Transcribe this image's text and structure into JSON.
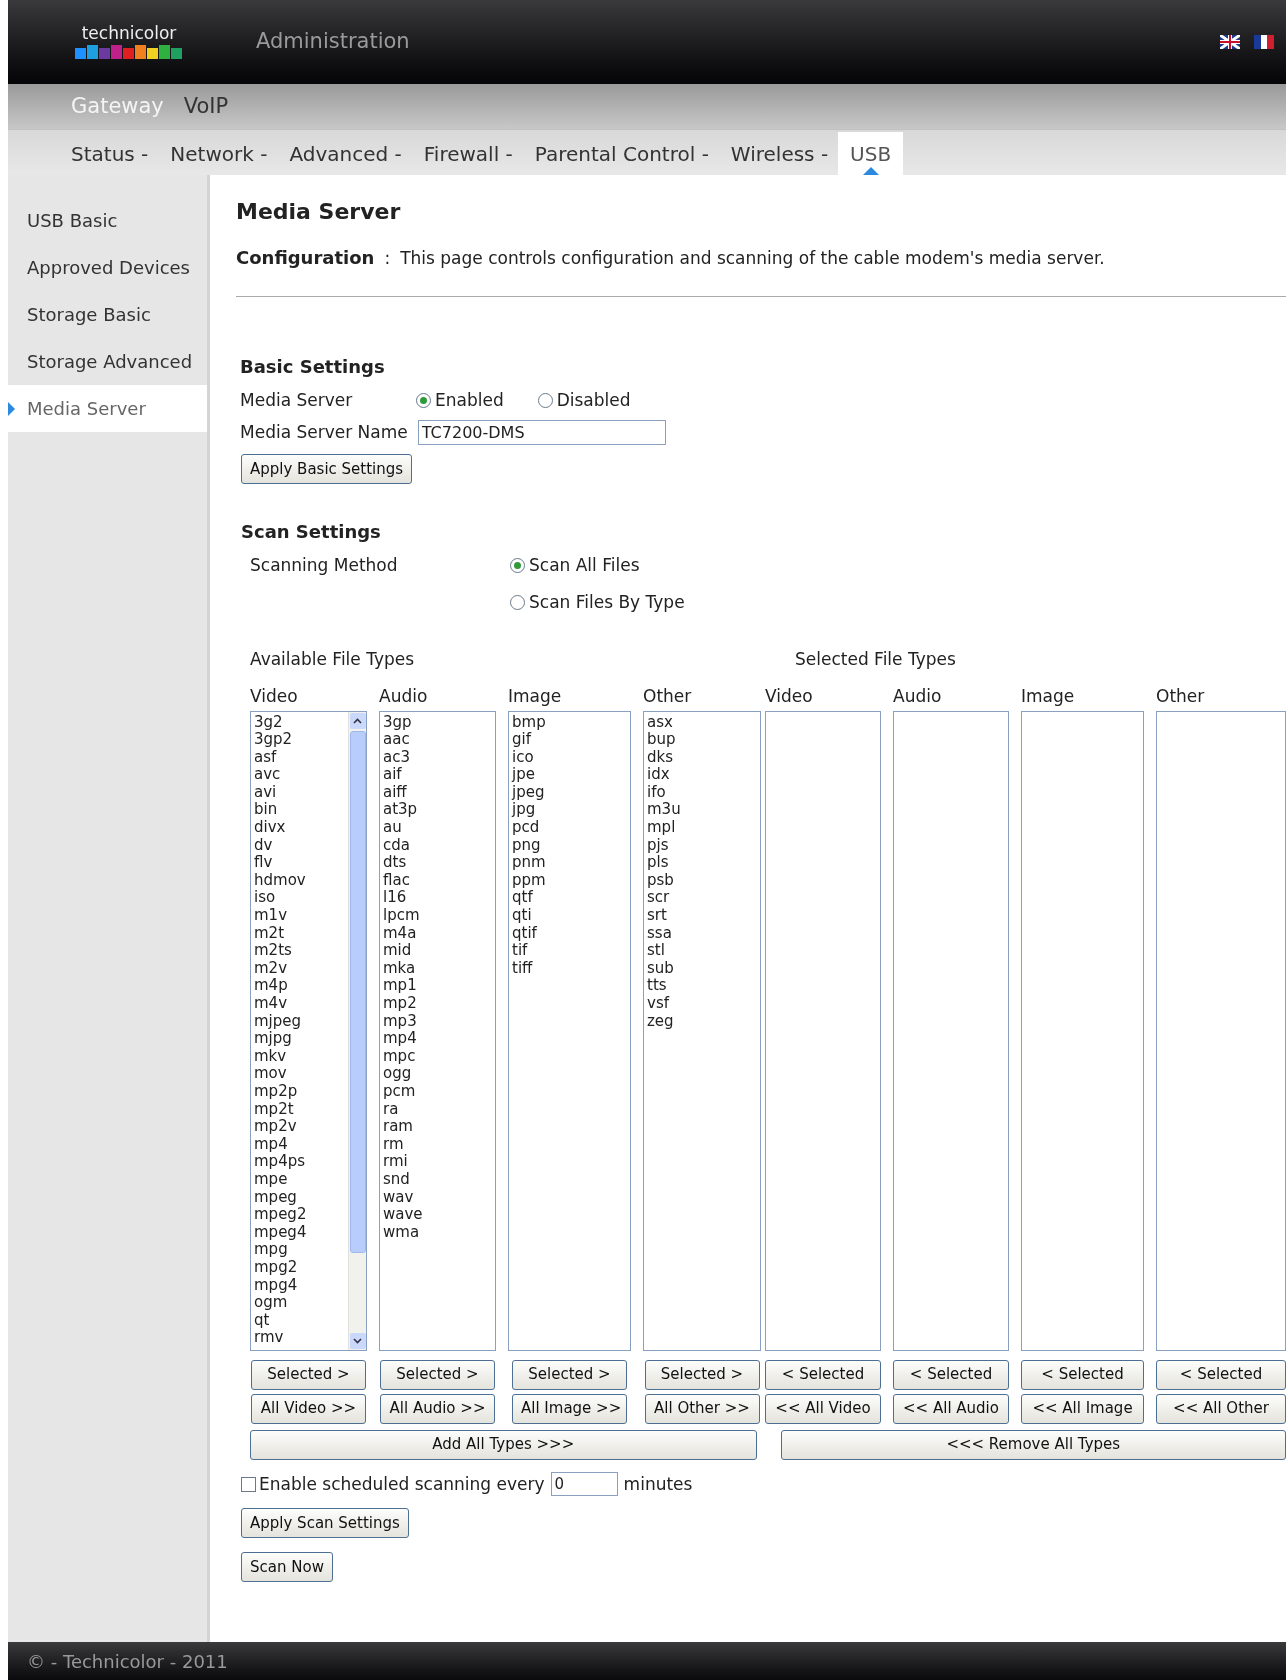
{
  "header": {
    "brand": "technicolor",
    "title": "Administration"
  },
  "top_nav": [
    {
      "label": "Gateway",
      "selected": true
    },
    {
      "label": "VoIP",
      "selected": false
    }
  ],
  "sub_nav": [
    {
      "label": "Status -",
      "selected": false
    },
    {
      "label": "Network -",
      "selected": false
    },
    {
      "label": "Advanced -",
      "selected": false
    },
    {
      "label": "Firewall -",
      "selected": false
    },
    {
      "label": "Parental Control -",
      "selected": false
    },
    {
      "label": "Wireless -",
      "selected": false
    },
    {
      "label": "USB",
      "selected": true
    }
  ],
  "sidebar": [
    {
      "label": "USB Basic",
      "selected": false
    },
    {
      "label": "Approved Devices",
      "selected": false
    },
    {
      "label": "Storage Basic",
      "selected": false
    },
    {
      "label": "Storage Advanced",
      "selected": false
    },
    {
      "label": "Media Server",
      "selected": true
    }
  ],
  "page": {
    "title": "Media Server",
    "config_label": "Configuration",
    "config_sep": ":",
    "config_text": "This page controls configuration and scanning of the cable modem's media server."
  },
  "basic": {
    "heading": "Basic Settings",
    "media_server_label": "Media Server",
    "media_server_options": [
      {
        "label": "Enabled",
        "selected": true
      },
      {
        "label": "Disabled",
        "selected": false
      }
    ],
    "name_label": "Media Server Name",
    "name_value": "TC7200-DMS",
    "apply": "Apply Basic Settings"
  },
  "scan": {
    "heading": "Scan Settings",
    "method_label": "Scanning Method",
    "method_options": [
      {
        "label": "Scan All Files",
        "selected": true
      },
      {
        "label": "Scan Files By Type",
        "selected": false
      }
    ],
    "available_label": "Available File Types",
    "selected_label": "Selected File Types",
    "available": [
      {
        "name": "Video",
        "scrollbar": true,
        "items": [
          "3g2",
          "3gp2",
          "asf",
          "avc",
          "avi",
          "bin",
          "divx",
          "dv",
          "flv",
          "hdmov",
          "iso",
          "m1v",
          "m2t",
          "m2ts",
          "m2v",
          "m4p",
          "m4v",
          "mjpeg",
          "mjpg",
          "mkv",
          "mov",
          "mp2p",
          "mp2t",
          "mp2v",
          "mp4",
          "mp4ps",
          "mpe",
          "mpeg",
          "mpeg2",
          "mpeg4",
          "mpg",
          "mpg2",
          "mpg4",
          "ogm",
          "qt",
          "rmv"
        ],
        "button_selected": "Selected >",
        "button_all": "All Video >>"
      },
      {
        "name": "Audio",
        "scrollbar": false,
        "items": [
          "3gp",
          "aac",
          "ac3",
          "aif",
          "aiff",
          "at3p",
          "au",
          "cda",
          "dts",
          "flac",
          "l16",
          "lpcm",
          "m4a",
          "mid",
          "mka",
          "mp1",
          "mp2",
          "mp3",
          "mp4",
          "mpc",
          "ogg",
          "pcm",
          "ra",
          "ram",
          "rm",
          "rmi",
          "snd",
          "wav",
          "wave",
          "wma"
        ],
        "button_selected": "Selected >",
        "button_all": "All Audio >>"
      },
      {
        "name": "Image",
        "scrollbar": false,
        "items": [
          "bmp",
          "gif",
          "ico",
          "jpe",
          "jpeg",
          "jpg",
          "pcd",
          "png",
          "pnm",
          "ppm",
          "qtf",
          "qti",
          "qtif",
          "tif",
          "tiff"
        ],
        "button_selected": "Selected >",
        "button_all": "All Image >>"
      },
      {
        "name": "Other",
        "scrollbar": false,
        "items": [
          "asx",
          "bup",
          "dks",
          "idx",
          "ifo",
          "m3u",
          "mpl",
          "pjs",
          "pls",
          "psb",
          "scr",
          "srt",
          "ssa",
          "stl",
          "sub",
          "tts",
          "vsf",
          "zeg"
        ],
        "button_selected": "Selected >",
        "button_all": "All Other >>"
      }
    ],
    "selected": [
      {
        "name": "Video",
        "button_selected": "< Selected",
        "button_all": "<< All Video"
      },
      {
        "name": "Audio",
        "button_selected": "< Selected",
        "button_all": "<< All Audio"
      },
      {
        "name": "Image",
        "button_selected": "< Selected",
        "button_all": "<< All Image"
      },
      {
        "name": "Other",
        "button_selected": "< Selected",
        "button_all": "<< All Other"
      }
    ],
    "add_all": "Add All Types >>>",
    "remove_all": "<<< Remove All Types",
    "schedule": {
      "checked": false,
      "label": "Enable scheduled scanning every",
      "value": "0",
      "unit": "minutes"
    },
    "apply": "Apply Scan Settings",
    "scan_now": "Scan Now"
  },
  "footer": "© - Technicolor - 2011"
}
